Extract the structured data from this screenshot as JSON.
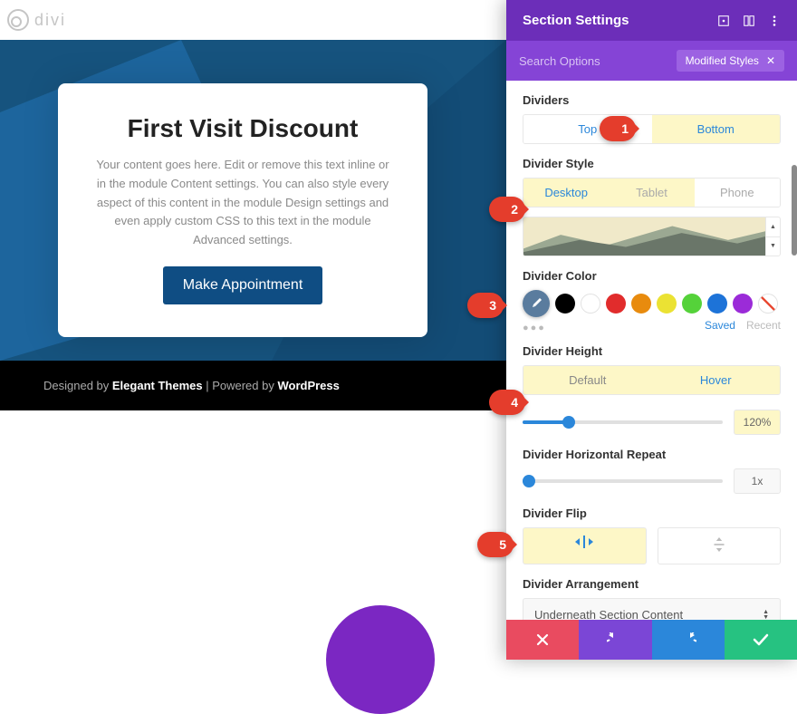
{
  "logo_text": "divi",
  "hero": {
    "title": "First Visit Discount",
    "body": "Your content goes here. Edit or remove this text inline or in the module Content settings. You can also style every aspect of this content in the module Design settings and even apply custom CSS to this text in the module Advanced settings.",
    "cta_label": "Make Appointment"
  },
  "footer": {
    "designed_by": "Designed by ",
    "designer": "Elegant Themes",
    "sep": " | Powered by ",
    "power": "WordPress"
  },
  "panel": {
    "title": "Section Settings",
    "search_label": "Search Options",
    "filter_pill": "Modified Styles"
  },
  "dividers": {
    "label": "Dividers",
    "top": "Top",
    "bottom": "Bottom"
  },
  "divider_style": {
    "label": "Divider Style",
    "desktop": "Desktop",
    "tablet": "Tablet",
    "phone": "Phone"
  },
  "divider_color": {
    "label": "Divider Color",
    "picker_selected": "#5a7c9e",
    "swatches": [
      "#000000",
      "#ffffff",
      "#e12c2c",
      "#e88b0e",
      "#ebe233",
      "#55d23a",
      "#1d73d8",
      "#9b2bd8"
    ],
    "saved": "Saved",
    "recent": "Recent"
  },
  "divider_height": {
    "label": "Divider Height",
    "default": "Default",
    "hover": "Hover",
    "value": "120%",
    "percent": 23
  },
  "divider_repeat": {
    "label": "Divider Horizontal Repeat",
    "value": "1x",
    "percent": 3
  },
  "divider_flip": {
    "label": "Divider Flip"
  },
  "divider_arr": {
    "label": "Divider Arrangement",
    "value": "Underneath Section Content"
  },
  "callouts": [
    "1",
    "2",
    "3",
    "4",
    "5"
  ]
}
